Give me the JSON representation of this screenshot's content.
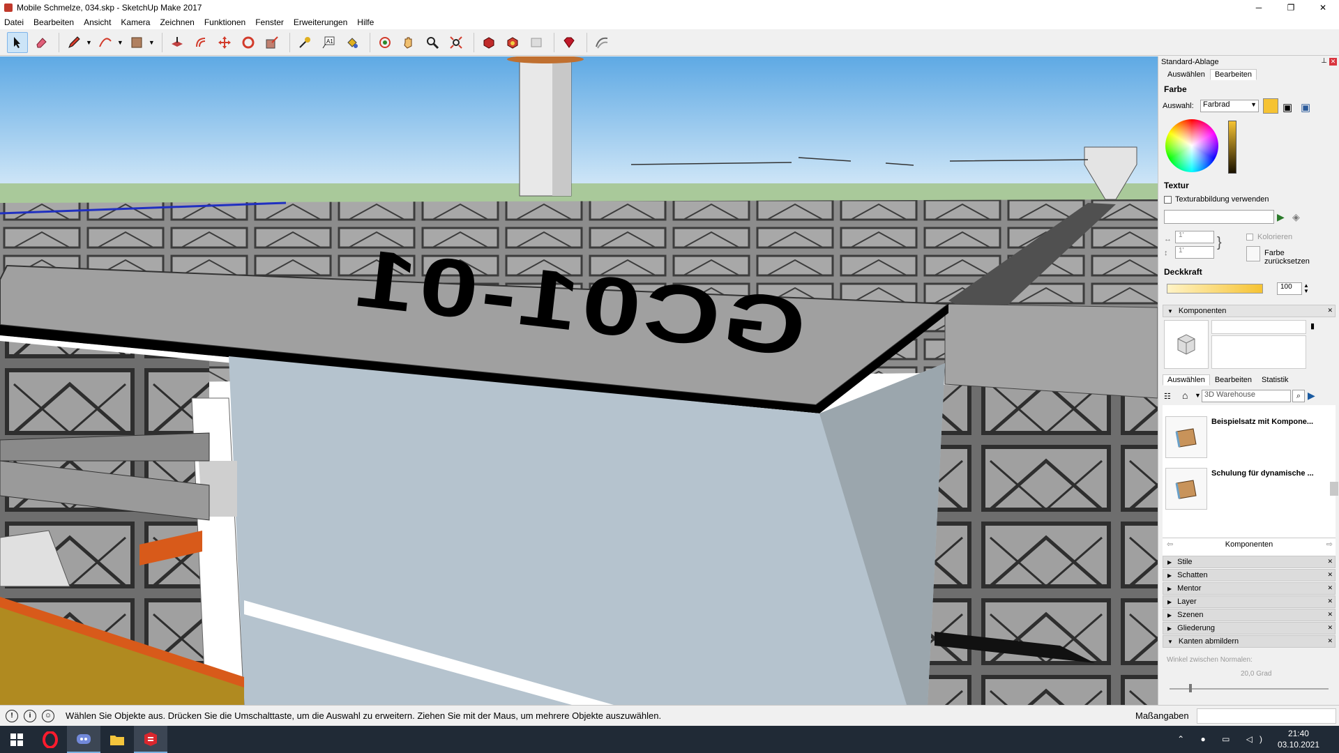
{
  "window": {
    "title": "Mobile Schmelze, 034.skp - SketchUp Make 2017",
    "minimize": "─",
    "maximize": "❐",
    "close": "✕"
  },
  "menu": [
    "Datei",
    "Bearbeiten",
    "Ansicht",
    "Kamera",
    "Zeichnen",
    "Funktionen",
    "Fenster",
    "Erweiterungen",
    "Hilfe"
  ],
  "toolbar": {
    "tools": [
      {
        "name": "select-tool",
        "icon": "arrow-cursor-icon",
        "active": true
      },
      {
        "name": "eraser-tool",
        "icon": "eraser-icon"
      },
      {
        "name": "line-tool",
        "icon": "pencil-icon",
        "dropdown": true
      },
      {
        "name": "arc-tool",
        "icon": "arc-icon",
        "dropdown": true
      },
      {
        "name": "rectangle-tool",
        "icon": "rectangle-icon",
        "dropdown": true
      },
      {
        "name": "push-pull-tool",
        "icon": "push-pull-icon"
      },
      {
        "name": "offset-tool",
        "icon": "offset-icon"
      },
      {
        "name": "move-tool",
        "icon": "move-icon"
      },
      {
        "name": "rotate-tool",
        "icon": "rotate-icon"
      },
      {
        "name": "scale-tool",
        "icon": "scale-icon"
      },
      {
        "name": "tape-measure-tool",
        "icon": "tape-measure-icon"
      },
      {
        "name": "text-tool",
        "icon": "text-a1-icon"
      },
      {
        "name": "paint-bucket-tool",
        "icon": "paint-bucket-icon"
      },
      {
        "name": "orbit-tool",
        "icon": "orbit-icon"
      },
      {
        "name": "pan-tool",
        "icon": "hand-icon"
      },
      {
        "name": "zoom-tool",
        "icon": "magnifier-icon"
      },
      {
        "name": "zoom-extents-tool",
        "icon": "zoom-extents-icon"
      },
      {
        "name": "warehouse-tool",
        "icon": "3d-warehouse-icon"
      },
      {
        "name": "extension-warehouse-tool",
        "icon": "extension-warehouse-icon"
      },
      {
        "name": "send-to-layout-tool",
        "icon": "layout-icon"
      },
      {
        "name": "extension-manager-tool",
        "icon": "ruby-gem-icon"
      },
      {
        "name": "sandbox-tool",
        "icon": "sandbox-icon"
      }
    ]
  },
  "viewport": {
    "model_label": "GC01-01"
  },
  "tray": {
    "title": "Standard-Ablage",
    "materials_tabs": [
      "Auswählen",
      "Bearbeiten"
    ],
    "materials_selected_tab": 1,
    "color_section": "Farbe",
    "selection_label": "Auswahl:",
    "selection_value": "Farbrad",
    "current_color": "#f6c333",
    "texture_section": "Textur",
    "texture_checkbox_label": "Texturabbildung verwenden",
    "width_value": "1'",
    "height_value": "1'",
    "colorize_label": "Kolorieren",
    "reset_color_label": "Farbe zurücksetzen",
    "opacity_section": "Deckkraft",
    "opacity_value": "100",
    "components_section": "Komponenten",
    "components_tabs": [
      "Auswählen",
      "Bearbeiten",
      "Statistik"
    ],
    "components_selected_tab": 0,
    "search_placeholder": "3D Warehouse",
    "items": [
      {
        "name": "Beispielsatz mit Kompone..."
      },
      {
        "name": "Schulung für dynamische ..."
      }
    ],
    "components_footer": "Komponenten",
    "collapsed_sections": [
      "Stile",
      "Schatten",
      "Mentor",
      "Layer",
      "Szenen",
      "Gliederung"
    ],
    "expanded_section": "Kanten abmildern",
    "normals_label": "Winkel zwischen Normalen:",
    "normals_value": "20,0  Grad"
  },
  "status": {
    "message": "Wählen Sie Objekte aus. Drücken Sie die Umschalttaste, um die Auswahl zu erweitern. Ziehen Sie mit der Maus, um mehrere Objekte auszuwählen.",
    "measurements_label": "Maßangaben"
  },
  "taskbar": {
    "time": "21:40",
    "date": "03.10.2021",
    "apps": [
      "windows-start-icon",
      "opera-icon",
      "discord-icon",
      "file-explorer-icon",
      "sketchup-icon"
    ]
  }
}
